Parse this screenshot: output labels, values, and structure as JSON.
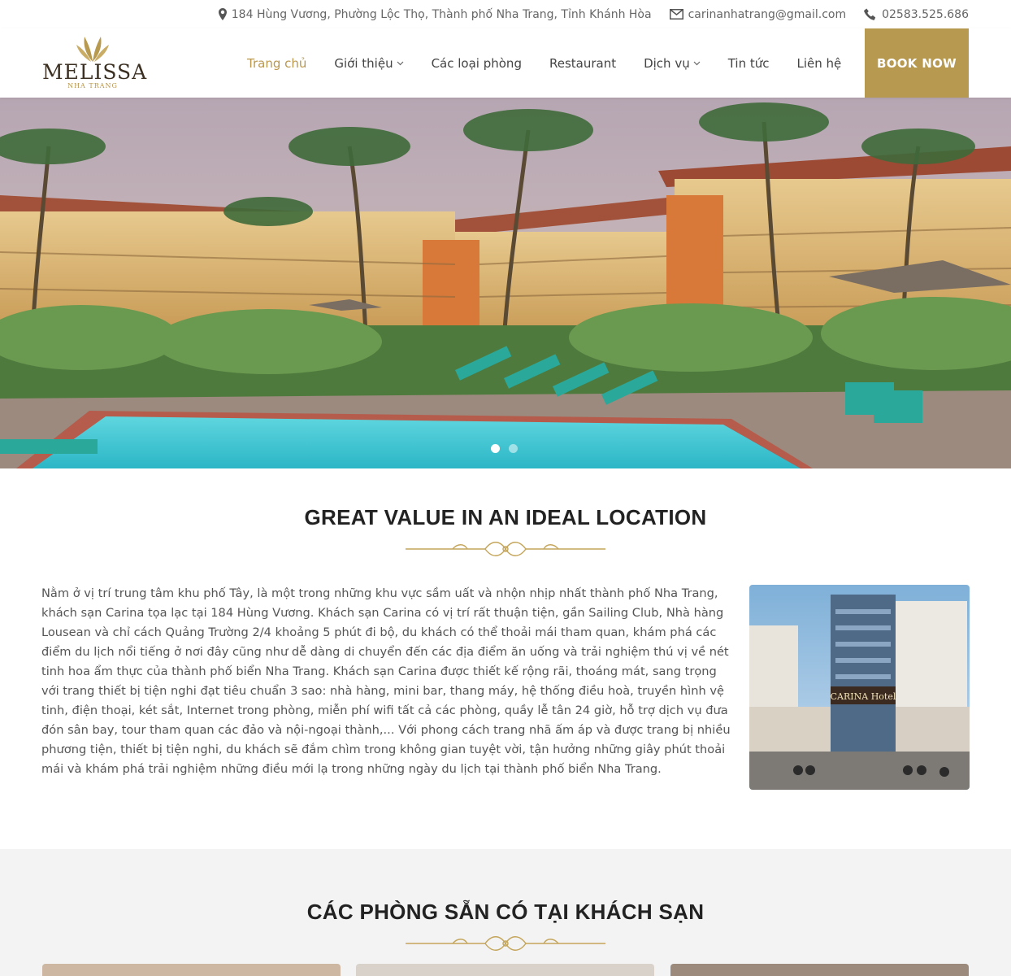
{
  "topbar": {
    "address": "184 Hùng Vương, Phường Lộc Thọ, Thành phố Nha Trang, Tỉnh Khánh Hòa",
    "email": "carinanhatrang@gmail.com",
    "phone": "02583.525.686",
    "icons": [
      "map-pin-icon",
      "envelope-icon",
      "phone-icon"
    ]
  },
  "brand": {
    "name": "MELISSA",
    "sub": "NHA TRANG",
    "color": "#b79a4f"
  },
  "nav": {
    "items": [
      {
        "label": "Trang chủ",
        "active": true,
        "has_dropdown": false
      },
      {
        "label": "Giới thiệu",
        "active": false,
        "has_dropdown": true
      },
      {
        "label": "Các loại phòng",
        "active": false,
        "has_dropdown": false
      },
      {
        "label": "Restaurant",
        "active": false,
        "has_dropdown": false
      },
      {
        "label": "Dịch vụ",
        "active": false,
        "has_dropdown": true
      },
      {
        "label": "Tin tức",
        "active": false,
        "has_dropdown": false
      },
      {
        "label": "Liên hệ",
        "active": false,
        "has_dropdown": false
      }
    ],
    "book_label": "BOOK NOW"
  },
  "slider": {
    "slide_count": 2,
    "active_index": 0
  },
  "intro": {
    "title": "GREAT VALUE IN AN IDEAL LOCATION",
    "body": "Nằm ở vị trí trung tâm khu phố Tây, là một trong những khu vực sầm uất và nhộn nhịp nhất thành phố Nha Trang, khách sạn Carina tọa lạc tại 184 Hùng Vương. Khách sạn Carina có vị trí rất thuận tiện, gần Sailing Club, Nhà hàng Lousean và chỉ cách Quảng Trường 2/4 khoảng 5 phút đi bộ, du khách có thể thoải mái tham quan, khám phá các điểm du lịch nổi tiếng ở nơi đây cũng như dễ dàng di chuyển đến các địa điểm ăn uống và trải nghiệm thú vị về nét tinh hoa ẩm thực của thành phố biển Nha Trang. Khách sạn Carina được thiết kế rộng rãi, thoáng mát, sang trọng với trang thiết bị tiện nghi đạt tiêu chuẩn 3 sao: nhà hàng, mini bar, thang máy, hệ thống điều hoà, truyền hình vệ tinh, điện thoại, két sắt, Internet trong phòng, miễn phí wifi tất cả các phòng, quầy lễ tân 24 giờ, hỗ trợ dịch vụ đưa đón sân bay, tour tham quan các đảo và nội-ngoại thành,... Với phong cách trang nhã ấm áp và được trang bị nhiều phương tiện, thiết bị tiện nghi, du khách sẽ đắm chìm trong không gian tuyệt vời, tận hưởng những giây phút thoải mái và khám phá trải nghiệm những điều mới lạ trong những ngày du lịch tại thành phố biển Nha Trang.",
    "hotel_sign": "CARINA Hotel"
  },
  "rooms": {
    "title": "CÁC PHÒNG SẴN CÓ TẠI KHÁCH SẠN",
    "card_count": 3
  }
}
